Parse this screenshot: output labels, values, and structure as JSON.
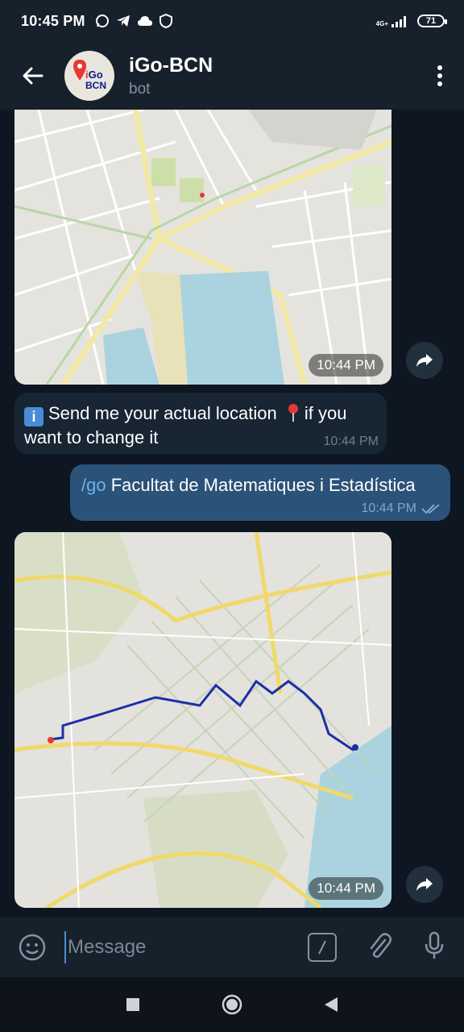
{
  "status_bar": {
    "time": "10:45 PM",
    "network_label": "4G+",
    "battery": "71",
    "icons": [
      "whatsapp-icon",
      "telegram-icon",
      "cloud-icon",
      "shield-icon",
      "signal-icon"
    ]
  },
  "header": {
    "title": "iGo-BCN",
    "subtitle": "bot",
    "avatar_line1_prefix": "i",
    "avatar_line1_rest": "Go",
    "avatar_line2": "BCN"
  },
  "messages": [
    {
      "type": "map_image",
      "direction": "incoming",
      "time": "10:44 PM"
    },
    {
      "type": "text",
      "direction": "incoming",
      "text_line1": "Send me your actual location",
      "text_line1_after": "if you",
      "text_line2": "want to change it",
      "time": "10:44 PM"
    },
    {
      "type": "text",
      "direction": "outgoing",
      "command": "/go",
      "text": "Facultat de Matematiques i Estadística",
      "time": "10:44 PM",
      "status": "read"
    },
    {
      "type": "map_image",
      "direction": "incoming",
      "time": "10:44 PM"
    }
  ],
  "composer": {
    "placeholder": "Message"
  },
  "colors": {
    "background": "#0e1621",
    "header": "#17212b",
    "incoming_bubble": "#182533",
    "outgoing_bubble": "#2b5278",
    "accent": "#6ab3f3",
    "route": "#1c2fa8"
  }
}
